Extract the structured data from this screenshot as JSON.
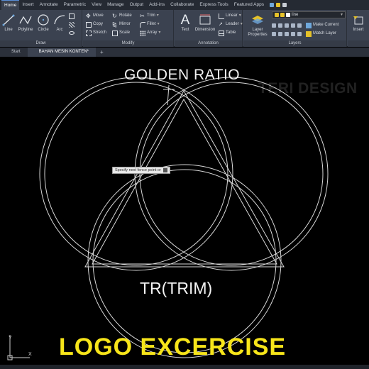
{
  "ribbon": {
    "tabs": [
      "Home",
      "Insert",
      "Annotate",
      "Parametric",
      "View",
      "Manage",
      "Output",
      "Add-ins",
      "Collaborate",
      "Express Tools",
      "Featured Apps"
    ],
    "active_tab": "Home"
  },
  "panels": {
    "draw": {
      "title": "Draw",
      "line": "Line",
      "polyline": "Polyline",
      "circle": "Circle",
      "arc": "Arc"
    },
    "modify": {
      "title": "Modify",
      "move": "Move",
      "rotate": "Rotate",
      "trim": "Trim",
      "copy": "Copy",
      "mirror": "Mirror",
      "fillet": "Fillet",
      "stretch": "Stretch",
      "scale": "Scale",
      "array": "Array"
    },
    "annotation": {
      "title": "Annotation",
      "text": "Text",
      "dimension": "Dimension",
      "linear": "Linear",
      "leader": "Leader",
      "table": "Table"
    },
    "layers": {
      "title": "Layers",
      "layer_properties": "Layer\nProperties",
      "current_layer": "line",
      "make_current": "Make Current",
      "match_layer": "Match Layer"
    },
    "insert": {
      "label": "Insert"
    }
  },
  "file_tabs": {
    "start": "Start",
    "doc": "BAHAN MESIN KONTEN*",
    "plus": "+"
  },
  "canvas": {
    "heading": "GOLDEN RATIO",
    "command_text": "TR(TRIM)",
    "watermark": "TERI DESIGN",
    "tooltip": "Specify next fence point or"
  },
  "banner": "LOGO EXCERCISE",
  "colors": {
    "banner": "#f7e51a",
    "ribbon_bg": "#3b4250",
    "canvas_bg": "#000000",
    "geometry": "#d9d9d9"
  }
}
